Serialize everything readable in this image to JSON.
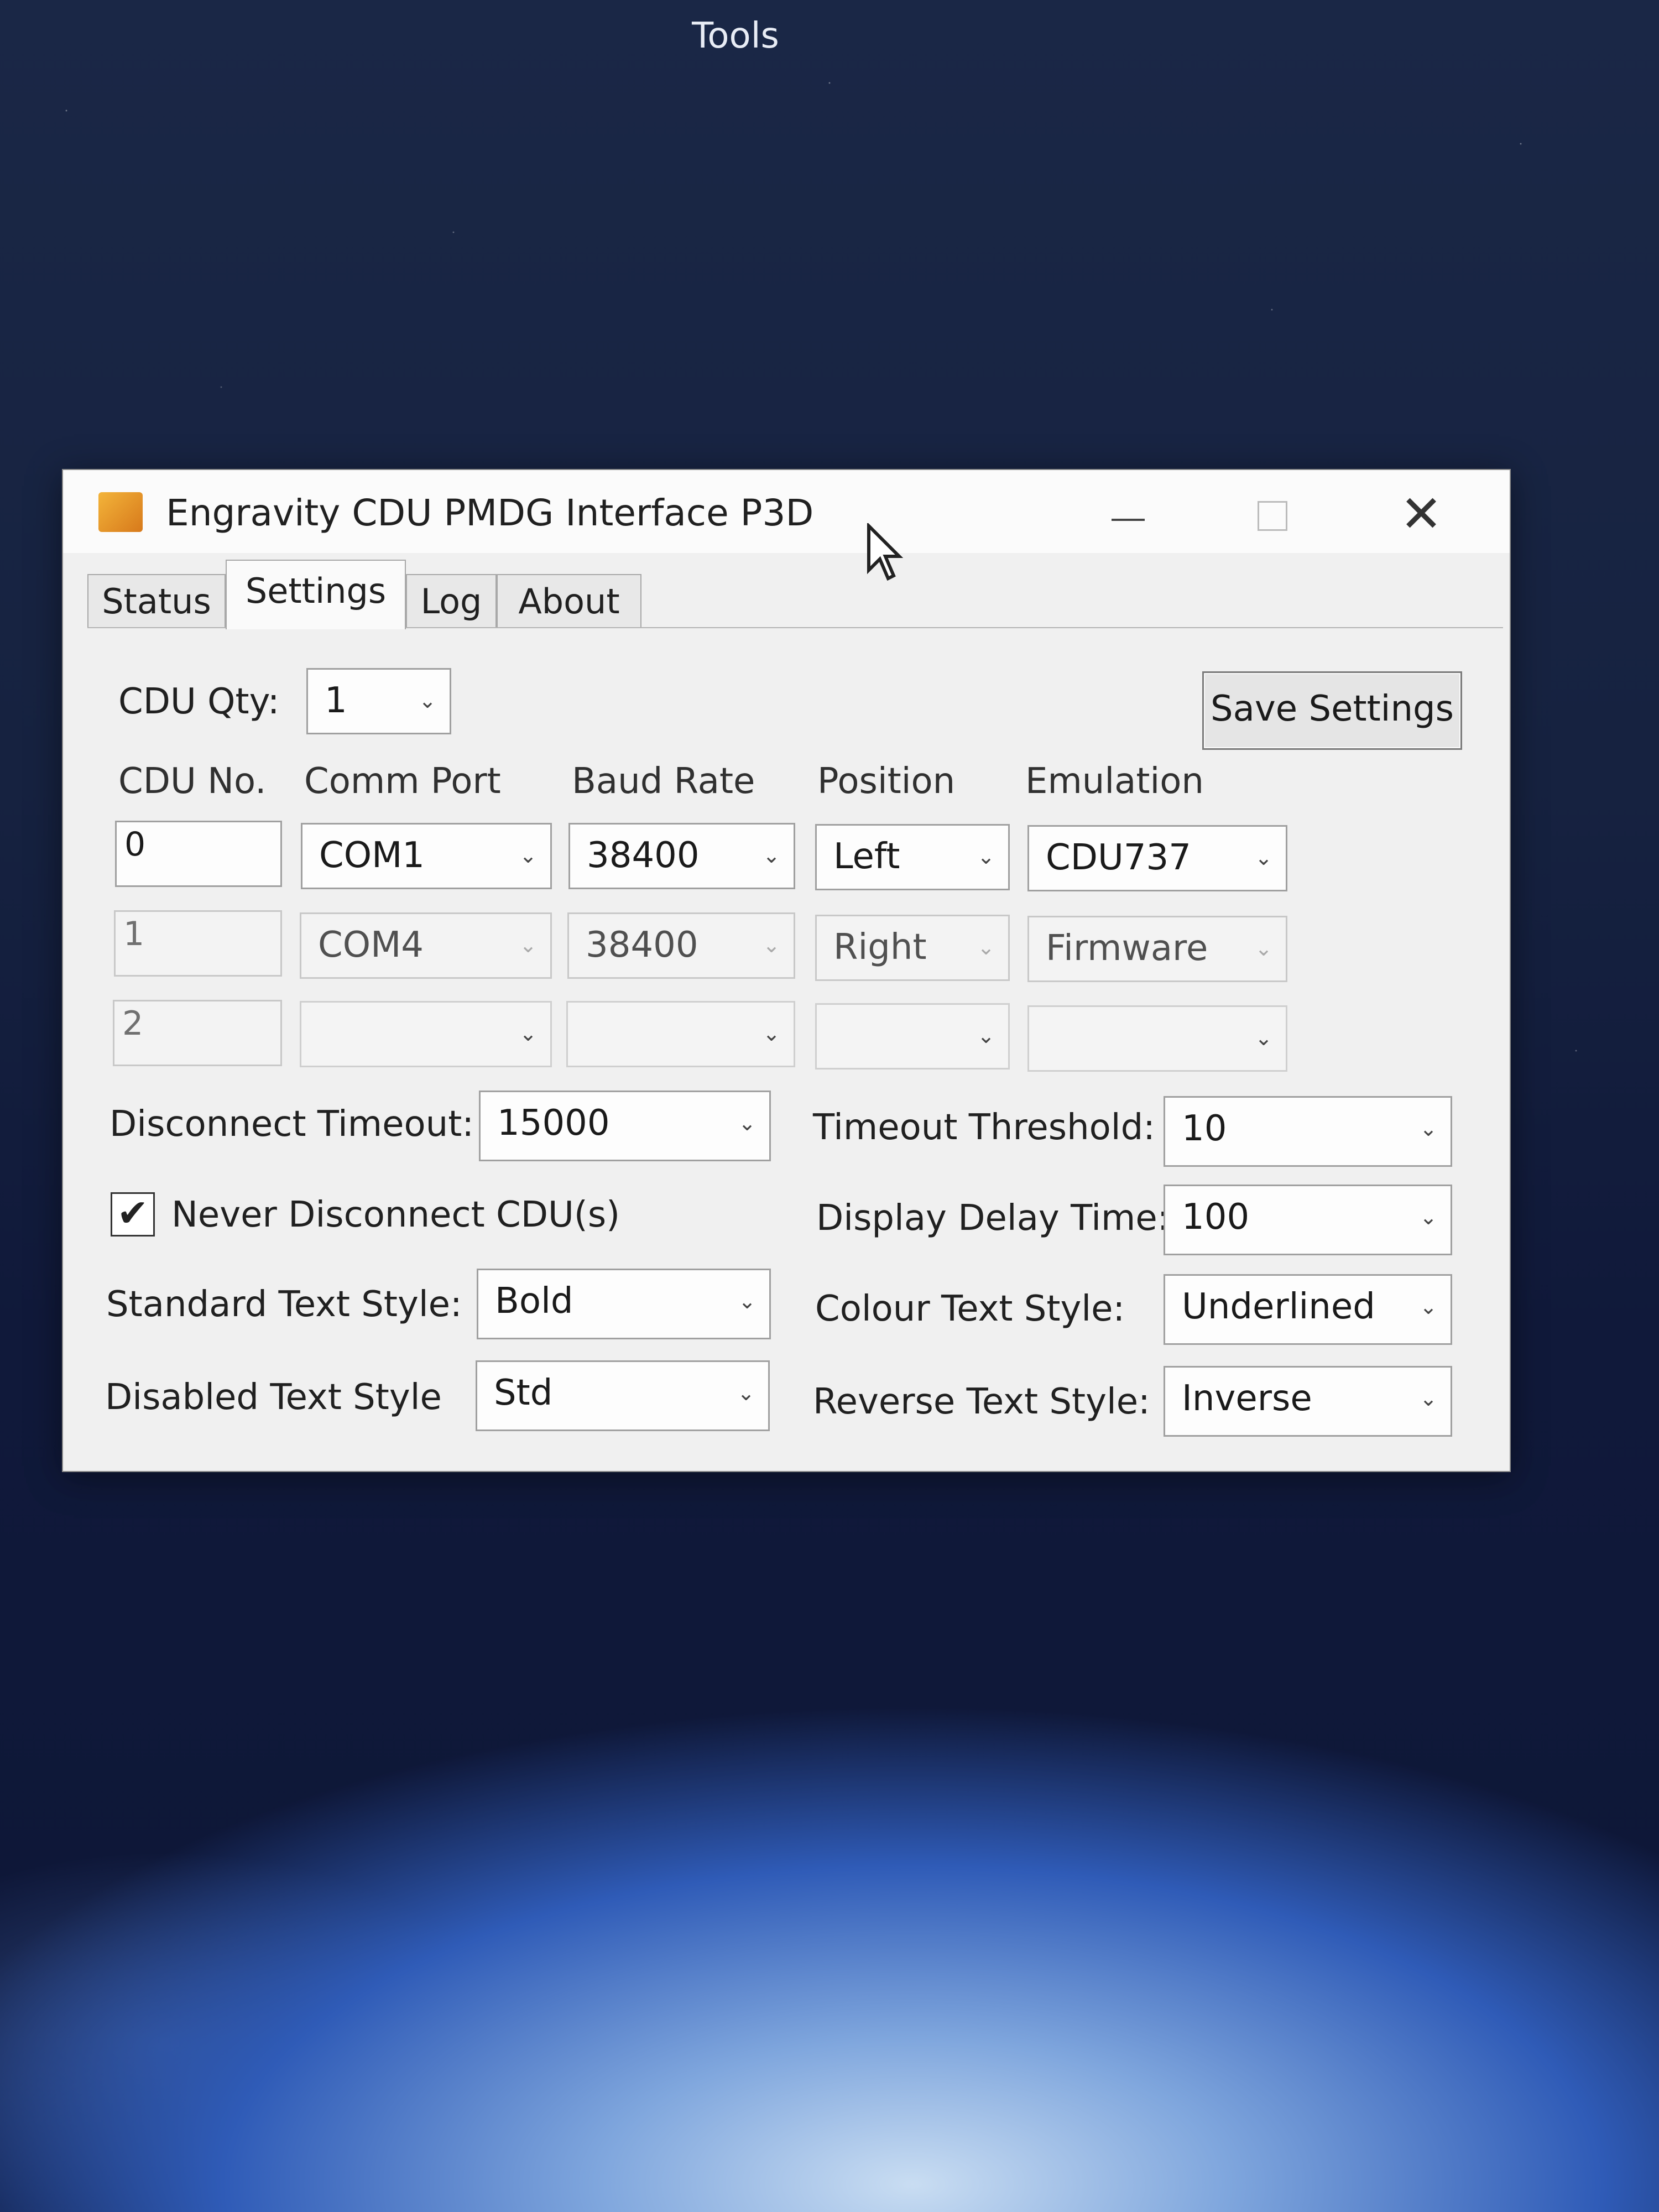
{
  "desktop": {
    "label": "Tools"
  },
  "window": {
    "title": "Engravity CDU PMDG Interface P3D",
    "close_glyph": "✕"
  },
  "tabs": [
    "Status",
    "Settings",
    "Log",
    "About"
  ],
  "active_tab": "Settings",
  "settings": {
    "cdu_qty_label": "CDU Qty:",
    "cdu_qty_value": "1",
    "save_button": "Save Settings",
    "headers": [
      "CDU No.",
      "Comm Port",
      "Baud Rate",
      "Position",
      "Emulation"
    ],
    "rows": [
      {
        "no": "0",
        "port": "COM1",
        "baud": "38400",
        "position": "Left",
        "emulation": "CDU737"
      },
      {
        "no": "1",
        "port": "COM4",
        "baud": "38400",
        "position": "Right",
        "emulation": "Firmware"
      },
      {
        "no": "2",
        "port": "",
        "baud": "",
        "position": "",
        "emulation": ""
      }
    ],
    "disconnect_timeout": {
      "label": "Disconnect Timeout:",
      "value": "15000"
    },
    "timeout_threshold": {
      "label": "Timeout Threshold:",
      "value": "10"
    },
    "never_disconnect": {
      "label": "Never Disconnect CDU(s)",
      "checked": true,
      "mark": "✔"
    },
    "display_delay": {
      "label": "Display Delay Time:",
      "value": "100"
    },
    "standard_text_style": {
      "label": "Standard Text Style:",
      "value": "Bold"
    },
    "colour_text_style": {
      "label": "Colour Text Style:",
      "value": "Underlined"
    },
    "disabled_text_style": {
      "label": "Disabled Text Style",
      "value": "Std"
    },
    "reverse_text_style": {
      "label": "Reverse Text Style:",
      "value": "Inverse"
    }
  },
  "icons": {
    "dropdown": "chevron-down-icon",
    "app": "engravity-app-icon",
    "cursor": "mouse-pointer-icon"
  },
  "colors": {
    "window_bg": "#f0f0f0",
    "app_icon": "#e8952a"
  }
}
